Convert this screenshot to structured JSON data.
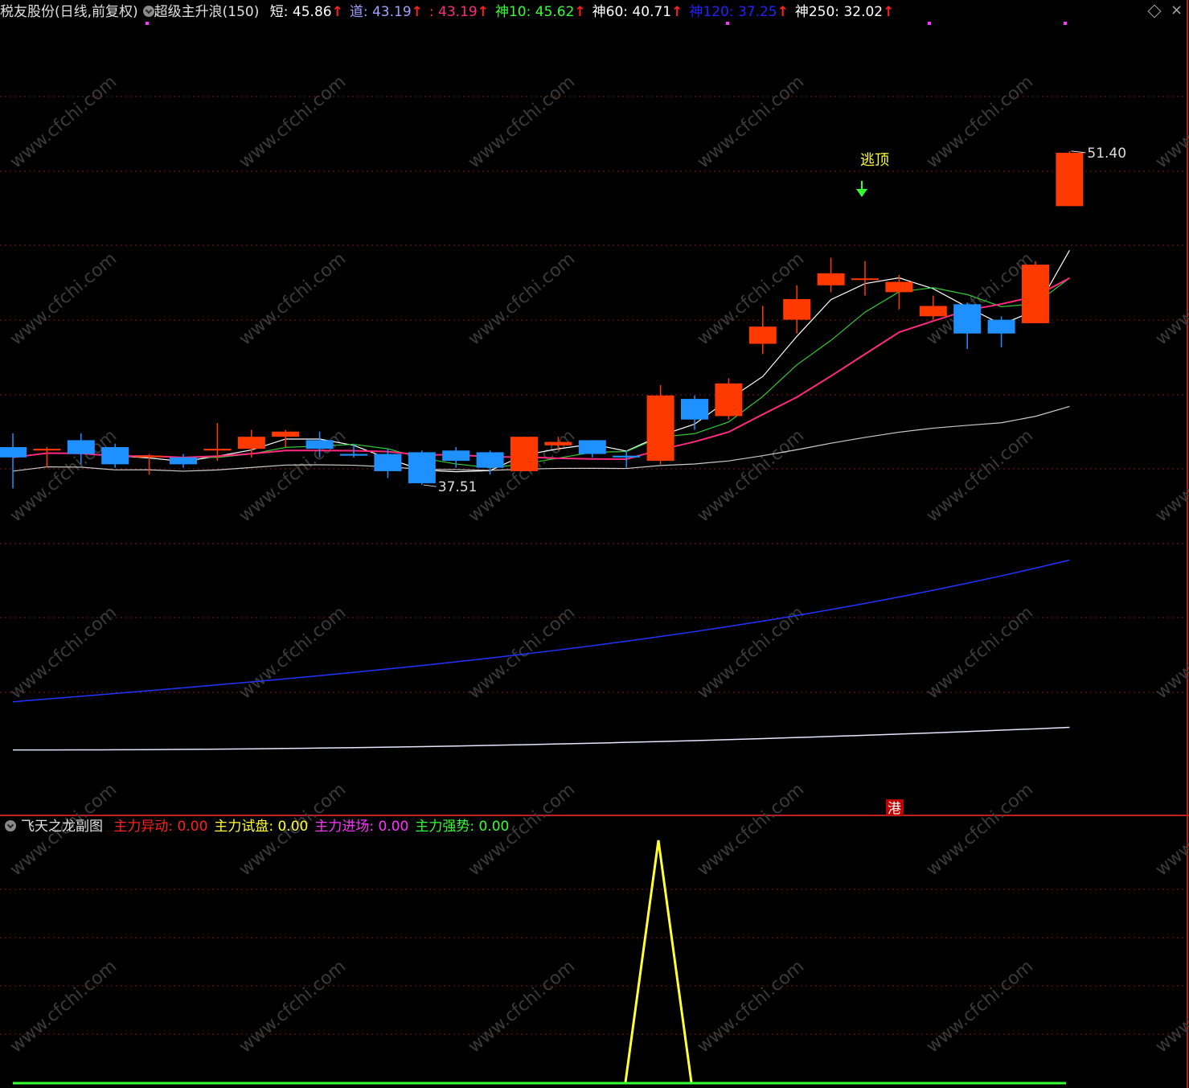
{
  "header": {
    "stock": "税友股份(日线,前复权)",
    "indicator": "超级主升浪(150)",
    "items": [
      {
        "label": "短: 45.86",
        "color": "#ffffff"
      },
      {
        "label": "道: 43.19",
        "color": "#a0a0ff"
      },
      {
        "label": ": 43.19",
        "color": "#ff2a80"
      },
      {
        "label": "神10: 45.62",
        "color": "#33ff33"
      },
      {
        "label": "神60: 40.71",
        "color": "#ffffff"
      },
      {
        "label": "神120: 37.25",
        "color": "#2222ff"
      },
      {
        "label": "神250: 32.02",
        "color": "#ffffff"
      }
    ]
  },
  "annotations": {
    "high": "51.40",
    "low": "37.51",
    "escape": "逃顶",
    "gang": "港"
  },
  "sub": {
    "title": "飞天之龙副图",
    "items": [
      {
        "label": "主力异动: 0.00",
        "color": "#ff2020"
      },
      {
        "label": "主力试盘: 0.00",
        "color": "#ffff33"
      },
      {
        "label": "主力进场: 0.00",
        "color": "#ff33ff"
      },
      {
        "label": "主力强势: 0.00",
        "color": "#33ff33"
      }
    ]
  },
  "watermark": "www.cfchi.com",
  "colors": {
    "up": "#ff3a00",
    "down": "#1e90ff",
    "grid": "#7a1a1a"
  },
  "chart_data": {
    "type": "candlestick",
    "candles": [
      {
        "o": 40.0,
        "h": 40.4,
        "l": 38.8,
        "c": 39.7
      },
      {
        "o": 39.9,
        "h": 40.0,
        "l": 39.4,
        "c": 39.95
      },
      {
        "o": 40.2,
        "h": 40.4,
        "l": 39.5,
        "c": 39.8
      },
      {
        "o": 40.0,
        "h": 40.1,
        "l": 39.4,
        "c": 39.5
      },
      {
        "o": 39.75,
        "h": 39.8,
        "l": 39.2,
        "c": 39.75
      },
      {
        "o": 39.7,
        "h": 39.8,
        "l": 39.4,
        "c": 39.5
      },
      {
        "o": 39.9,
        "h": 40.7,
        "l": 39.6,
        "c": 39.95
      },
      {
        "o": 39.95,
        "h": 40.5,
        "l": 39.7,
        "c": 40.3
      },
      {
        "o": 40.3,
        "h": 40.5,
        "l": 40.0,
        "c": 40.45
      },
      {
        "o": 40.2,
        "h": 40.45,
        "l": 39.7,
        "c": 39.95
      },
      {
        "o": 39.8,
        "h": 40.1,
        "l": 39.7,
        "c": 39.75
      },
      {
        "o": 39.8,
        "h": 39.95,
        "l": 39.1,
        "c": 39.3
      },
      {
        "o": 39.85,
        "h": 39.9,
        "l": 38.9,
        "c": 38.95
      },
      {
        "o": 39.9,
        "h": 40.0,
        "l": 39.4,
        "c": 39.6
      },
      {
        "o": 39.85,
        "h": 39.9,
        "l": 39.2,
        "c": 39.4
      },
      {
        "o": 39.3,
        "h": 40.3,
        "l": 39.3,
        "c": 40.3
      },
      {
        "o": 40.05,
        "h": 40.3,
        "l": 39.9,
        "c": 40.15
      },
      {
        "o": 40.2,
        "h": 40.2,
        "l": 39.7,
        "c": 39.8
      },
      {
        "o": 39.75,
        "h": 39.9,
        "l": 39.4,
        "c": 39.7
      },
      {
        "o": 39.6,
        "h": 41.8,
        "l": 39.5,
        "c": 41.5
      },
      {
        "o": 41.4,
        "h": 41.5,
        "l": 40.5,
        "c": 40.8
      },
      {
        "o": 40.9,
        "h": 42.0,
        "l": 40.8,
        "c": 41.85
      },
      {
        "o": 43.0,
        "h": 44.1,
        "l": 42.7,
        "c": 43.5
      },
      {
        "o": 43.7,
        "h": 44.7,
        "l": 43.3,
        "c": 44.3
      },
      {
        "o": 44.7,
        "h": 45.5,
        "l": 44.5,
        "c": 45.05
      },
      {
        "o": 44.9,
        "h": 45.4,
        "l": 44.4,
        "c": 44.9
      },
      {
        "o": 44.5,
        "h": 45.0,
        "l": 44.0,
        "c": 44.8
      },
      {
        "o": 43.8,
        "h": 44.4,
        "l": 43.7,
        "c": 44.1
      },
      {
        "o": 44.15,
        "h": 44.2,
        "l": 42.85,
        "c": 43.3
      },
      {
        "o": 43.7,
        "h": 43.8,
        "l": 42.9,
        "c": 43.3
      },
      {
        "o": 43.6,
        "h": 45.4,
        "l": 43.6,
        "c": 45.3
      },
      {
        "o": 47.0,
        "h": 48.6,
        "l": 47.0,
        "c": 48.55
      }
    ],
    "sub_series": [
      {
        "name": "主力试盘",
        "values": [
          0,
          0,
          0,
          0,
          0,
          0,
          0,
          0,
          0,
          0,
          0,
          0,
          0,
          0,
          0,
          0,
          0,
          0,
          0,
          0,
          1,
          0,
          0,
          0,
          0,
          0,
          0,
          0,
          0,
          0,
          0,
          0
        ]
      },
      {
        "name": "主力强势",
        "values": [
          0,
          0,
          0,
          0,
          0,
          0,
          0,
          0,
          0,
          0,
          0,
          0,
          0,
          0,
          0,
          0,
          0,
          0,
          0,
          0,
          0,
          0,
          0,
          0,
          0,
          0,
          0,
          0,
          0,
          0,
          0,
          0
        ]
      }
    ]
  }
}
